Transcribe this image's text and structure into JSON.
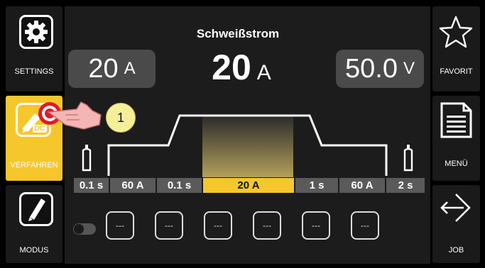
{
  "sidebar_left": {
    "settings_label": "SETTINGS",
    "process_label": "VERFAHREN",
    "process_badge": "DC",
    "mode_label": "MODUS"
  },
  "sidebar_right": {
    "favorite_label": "FAVORIT",
    "menu_label": "MENÜ",
    "job_label": "JOB"
  },
  "main": {
    "title": "Schweißstrom",
    "value": "20",
    "unit": "A",
    "left_display": {
      "value": "20",
      "unit": "A"
    },
    "right_display": {
      "value": "50.0",
      "unit": "V"
    },
    "callout_number": "1",
    "parameters": [
      "0.1 s",
      "60 A",
      "0.1 s",
      "20 A",
      "1 s",
      "60 A",
      "2 s"
    ],
    "active_parameter": "20 A",
    "slots": [
      "---",
      "---",
      "---",
      "---",
      "---",
      "---"
    ]
  },
  "colors": {
    "accent": "#f5c72c",
    "background": "#000000",
    "panel": "#1c1c1c",
    "pill": "#4a4a4a",
    "callout_red": "#e2182a"
  },
  "icons": {
    "settings": "gear-icon",
    "process": "electrode-icon",
    "mode": "torch-icon",
    "favorite": "star-icon",
    "menu": "document-menu-icon",
    "job": "arrows-icon",
    "gas": "gas-bottle-icon",
    "hand": "pointing-hand-icon"
  }
}
